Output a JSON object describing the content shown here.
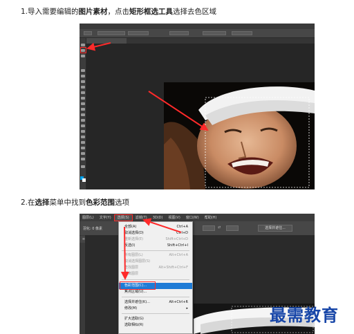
{
  "step1": {
    "prefix": "1.导入需要编辑的",
    "bold1": "图片素材",
    "middle": "，点击",
    "bold2": "矩形框选工具",
    "suffix": "选择去色区域"
  },
  "step2": {
    "prefix": "2.在",
    "bold1": "选择",
    "middle": "菜单中找到",
    "bold2": "色彩范围",
    "suffix": "选项"
  },
  "shot2": {
    "menubar": [
      "图层(L)",
      "文字(Y)",
      "选择(S)",
      "滤镜(T)",
      "3D(D)",
      "视图(V)",
      "窗口(W)",
      "帮助(H)"
    ],
    "active_menu": "选择(S)",
    "feather_label": "羽化: 0 像素",
    "select_mask_button": "选择并遮住...",
    "left_tab": "≡",
    "menu_items": [
      {
        "label": "全部(A)",
        "shortcut": "Ctrl+A",
        "disabled": false
      },
      {
        "label": "取消选择(D)",
        "shortcut": "Ctrl+D",
        "disabled": false
      },
      {
        "label": "重新选择(E)",
        "shortcut": "Shift+Ctrl+D",
        "disabled": true
      },
      {
        "label": "反选(I)",
        "shortcut": "Shift+Ctrl+I",
        "disabled": false
      },
      {
        "label": "所有图层(L)",
        "shortcut": "Alt+Ctrl+A",
        "disabled": true
      },
      {
        "label": "取消选择图层(S)",
        "shortcut": "",
        "disabled": true
      },
      {
        "label": "查找图层",
        "shortcut": "Alt+Shift+Ctrl+F",
        "disabled": true
      },
      {
        "label": "隔离图层",
        "shortcut": "",
        "disabled": true
      },
      {
        "label": "色彩范围(C)...",
        "shortcut": "",
        "disabled": false,
        "highlighted": true
      },
      {
        "label": "焦点区域(U)...",
        "shortcut": "",
        "disabled": false
      },
      {
        "label": "选择并遮住(K)...",
        "shortcut": "Alt+Ctrl+R",
        "disabled": false
      },
      {
        "label": "修改(M)",
        "shortcut": "▸",
        "disabled": false
      },
      {
        "label": "扩大选取(G)",
        "shortcut": "",
        "disabled": false
      },
      {
        "label": "选取相似(R)",
        "shortcut": "",
        "disabled": false
      }
    ]
  },
  "watermark": "最需教育",
  "colors": {
    "annotation_red": "#ff2a2a",
    "menu_highlight": "#1e7bd6",
    "watermark_blue": "#1746a8"
  }
}
